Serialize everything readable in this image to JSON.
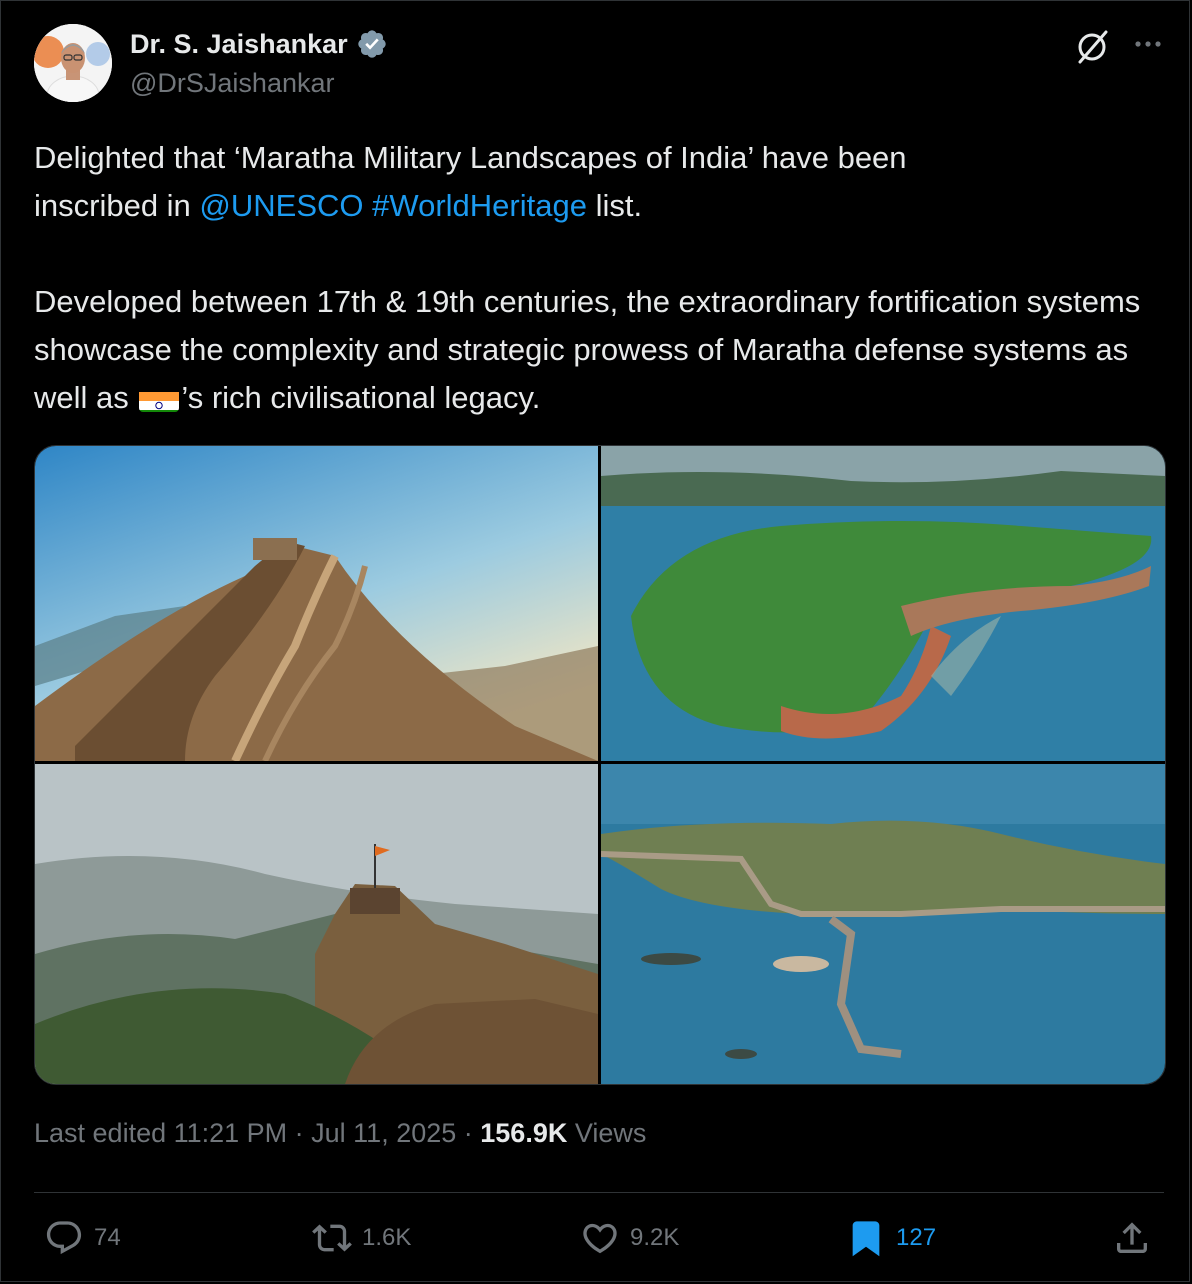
{
  "author": {
    "name": "Dr. S. Jaishankar",
    "handle": "@DrSJaishankar"
  },
  "tweet": {
    "line1_a": "Delighted that ‘Maratha Military Landscapes of India’ have been",
    "line2_a": "inscribed in ",
    "mention": "@UNESCO",
    "hashtag": "#WorldHeritage",
    "line2_b": " list.",
    "p2_a": "Developed between 17th & 19th centuries, the extraordinary fortification systems showcase the complexity and strategic prowess of Maratha defense systems as well as ",
    "p2_b": "’s rich civilisational legacy."
  },
  "meta": {
    "prefix": "Last edited 11:21 PM · Jul 11, 2025 · ",
    "views_count": "156.9K",
    "views_label": " Views"
  },
  "actions": {
    "replies": "74",
    "reposts": "1.6K",
    "likes": "9.2K",
    "bookmarks": "127"
  },
  "colors": {
    "background": "#000000",
    "text": "#e7e9ea",
    "muted": "#71767b",
    "link": "#1d9bf0",
    "divider": "#2f3336"
  },
  "icons": [
    "verified-badge-icon",
    "grok-icon",
    "more-icon",
    "reply-icon",
    "repost-icon",
    "like-icon",
    "bookmark-icon",
    "share-icon"
  ]
}
